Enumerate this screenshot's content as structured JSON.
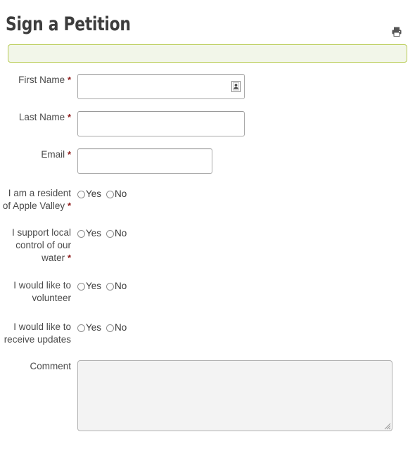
{
  "page": {
    "title": "Sign a Petition",
    "background_color": "#ffffff",
    "required_marker": "*"
  },
  "toolbar": {
    "print_icon": "printer-icon",
    "print_tooltip": "Print"
  },
  "notice": {
    "text": "",
    "background_color": "#f2f6e9",
    "border_color": "#b7cb52"
  },
  "form": {
    "fields": [
      {
        "name": "first-name",
        "label": "First Name",
        "required": true,
        "type": "text",
        "value": "",
        "placeholder": "",
        "icon": "autofill-contact-icon"
      },
      {
        "name": "last-name",
        "label": "Last Name",
        "required": true,
        "type": "text",
        "value": "",
        "placeholder": ""
      },
      {
        "name": "email",
        "label": "Email",
        "required": true,
        "type": "text",
        "value": "",
        "placeholder": ""
      },
      {
        "name": "resident",
        "label": "I am a resident of Apple Valley",
        "required": true,
        "type": "radio",
        "selected": ""
      },
      {
        "name": "support-water",
        "label": "I support local control of our water",
        "required": true,
        "type": "radio",
        "selected": ""
      },
      {
        "name": "volunteer",
        "label": "I would like to volunteer",
        "required": false,
        "type": "radio",
        "selected": ""
      },
      {
        "name": "updates",
        "label": "I would like to receive updates",
        "required": false,
        "type": "radio",
        "selected": ""
      },
      {
        "name": "comment",
        "label": "Comment",
        "required": false,
        "type": "textarea",
        "value": "",
        "placeholder": ""
      }
    ],
    "radio_options": {
      "yes": "Yes",
      "no": "No"
    }
  },
  "colors": {
    "required_asterisk": "#8f1d1d",
    "label_text": "#4a4a4a",
    "title_text": "#3d3d3d",
    "input_border": "#a9a9a9",
    "textarea_background": "#f3f3f3"
  }
}
